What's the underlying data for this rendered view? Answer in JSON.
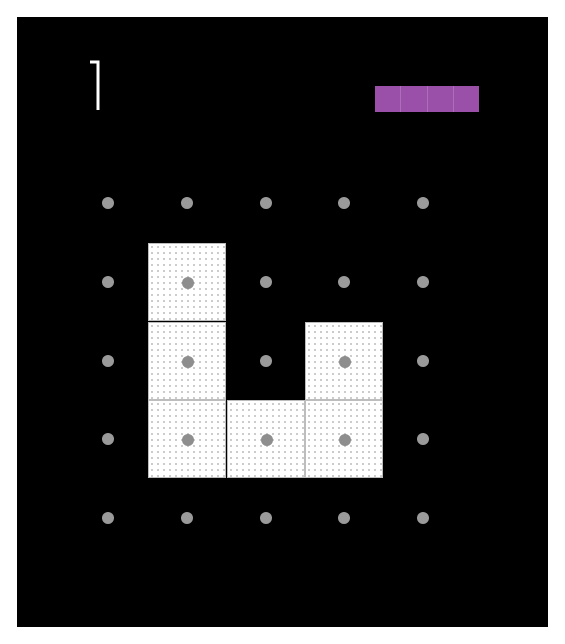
{
  "game": {
    "level_number": "7",
    "progress": {
      "segments": 4,
      "filled_fraction": 1.0,
      "color": "#9a4fa8"
    }
  },
  "grid": {
    "rows": 5,
    "cols": 5,
    "dot_color": "#9a9a9a",
    "filled_cells": [
      {
        "row": 1,
        "col": 1
      },
      {
        "row": 2,
        "col": 1
      },
      {
        "row": 3,
        "col": 1
      },
      {
        "row": 3,
        "col": 2
      },
      {
        "row": 3,
        "col": 3
      },
      {
        "row": 2,
        "col": 3
      }
    ]
  },
  "colors": {
    "background": "#000000",
    "frame": "#ffffff",
    "tile": "#ffffff"
  }
}
